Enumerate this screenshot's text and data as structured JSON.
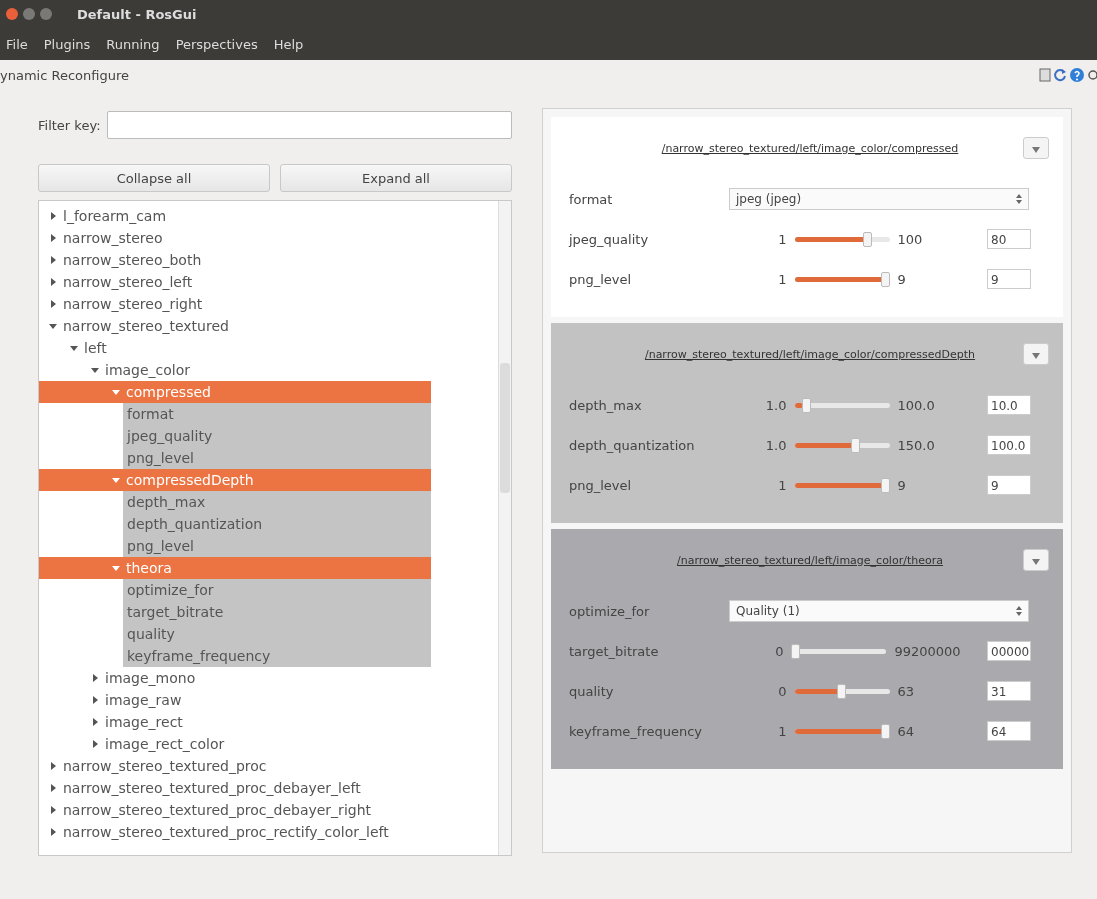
{
  "window": {
    "title": "Default - RosGui"
  },
  "menu": [
    "File",
    "Plugins",
    "Running",
    "Perspectives",
    "Help"
  ],
  "plugin": {
    "title": "ynamic Reconfigure"
  },
  "filter": {
    "label": "Filter key:"
  },
  "buttons": [
    "Collapse all",
    "Expand all"
  ],
  "tree": {
    "items": [
      {
        "label": "l_forearm_cam",
        "expanded": false,
        "selected": false
      },
      {
        "label": "narrow_stereo",
        "expanded": false,
        "selected": false
      },
      {
        "label": "narrow_stereo_both",
        "expanded": false,
        "selected": false
      },
      {
        "label": "narrow_stereo_left",
        "expanded": false,
        "selected": false
      },
      {
        "label": "narrow_stereo_right",
        "expanded": false,
        "selected": false
      },
      {
        "label": "narrow_stereo_textured",
        "expanded": true,
        "selected": false,
        "children": [
          {
            "label": "left",
            "expanded": true,
            "selected": false,
            "children": [
              {
                "label": "image_color",
                "expanded": true,
                "selected": false,
                "children": [
                  {
                    "label": "compressed",
                    "expanded": true,
                    "selected": true,
                    "children": [
                      {
                        "label": "format",
                        "selected": false
                      },
                      {
                        "label": "jpeg_quality",
                        "selected": false
                      },
                      {
                        "label": "png_level",
                        "selected": false
                      }
                    ]
                  },
                  {
                    "label": "compressedDepth",
                    "expanded": true,
                    "selected": true,
                    "children": [
                      {
                        "label": "depth_max",
                        "selected": false
                      },
                      {
                        "label": "depth_quantization",
                        "selected": false
                      },
                      {
                        "label": "png_level",
                        "selected": false
                      }
                    ]
                  },
                  {
                    "label": "theora",
                    "expanded": true,
                    "selected": true,
                    "children": [
                      {
                        "label": "optimize_for",
                        "selected": false
                      },
                      {
                        "label": "target_bitrate",
                        "selected": false
                      },
                      {
                        "label": "quality",
                        "selected": false
                      },
                      {
                        "label": "keyframe_frequency",
                        "selected": false
                      }
                    ]
                  }
                ]
              },
              {
                "label": "image_mono",
                "expanded": false,
                "selected": false
              },
              {
                "label": "image_raw",
                "expanded": false,
                "selected": false
              },
              {
                "label": "image_rect",
                "expanded": false,
                "selected": false
              },
              {
                "label": "image_rect_color",
                "expanded": false,
                "selected": false
              }
            ]
          }
        ]
      },
      {
        "label": "narrow_stereo_textured_proc",
        "expanded": false,
        "selected": false
      },
      {
        "label": "narrow_stereo_textured_proc_debayer_left",
        "expanded": false,
        "selected": false
      },
      {
        "label": "narrow_stereo_textured_proc_debayer_right",
        "expanded": false,
        "selected": false
      },
      {
        "label": "narrow_stereo_textured_proc_rectify_color_left",
        "expanded": false,
        "selected": false
      }
    ]
  },
  "groups": [
    {
      "title": "/narrow_stereo_textured/left/image_color/compressed",
      "color": "#ffffff",
      "params": [
        {
          "kind": "enum",
          "name": "format",
          "value": "jpeg (jpeg)"
        },
        {
          "kind": "slider",
          "name": "jpeg_quality",
          "min": "1",
          "max": "100",
          "level": 0.8,
          "value": "80"
        },
        {
          "kind": "slider",
          "name": "png_level",
          "min": "1",
          "max": "9",
          "level": 1.0,
          "value": "9"
        }
      ]
    },
    {
      "title": "/narrow_stereo_textured/left/image_color/compressedDepth",
      "color": "#c2c2c2",
      "params": [
        {
          "kind": "slider",
          "name": "depth_max",
          "min": "1.0",
          "max": "100.0",
          "level": 0.09,
          "value": "10.0"
        },
        {
          "kind": "slider",
          "name": "depth_quantization",
          "min": "1.0",
          "max": "150.0",
          "level": 0.66,
          "value": "100.0"
        },
        {
          "kind": "slider",
          "name": "png_level",
          "min": "1",
          "max": "9",
          "level": 1.0,
          "value": "9"
        }
      ]
    },
    {
      "title": "/narrow_stereo_textured/left/image_color/theora",
      "color": "#a9a9ae",
      "params": [
        {
          "kind": "enum",
          "name": "optimize_for",
          "value": "Quality (1)"
        },
        {
          "kind": "slider",
          "name": "target_bitrate",
          "min": "0",
          "max": "99200000",
          "level": 0.0,
          "value": "00000"
        },
        {
          "kind": "slider",
          "name": "quality",
          "min": "0",
          "max": "63",
          "level": 0.49,
          "value": "31"
        },
        {
          "kind": "slider",
          "name": "keyframe_frequency",
          "min": "1",
          "max": "64",
          "level": 1.0,
          "value": "64"
        }
      ]
    }
  ]
}
